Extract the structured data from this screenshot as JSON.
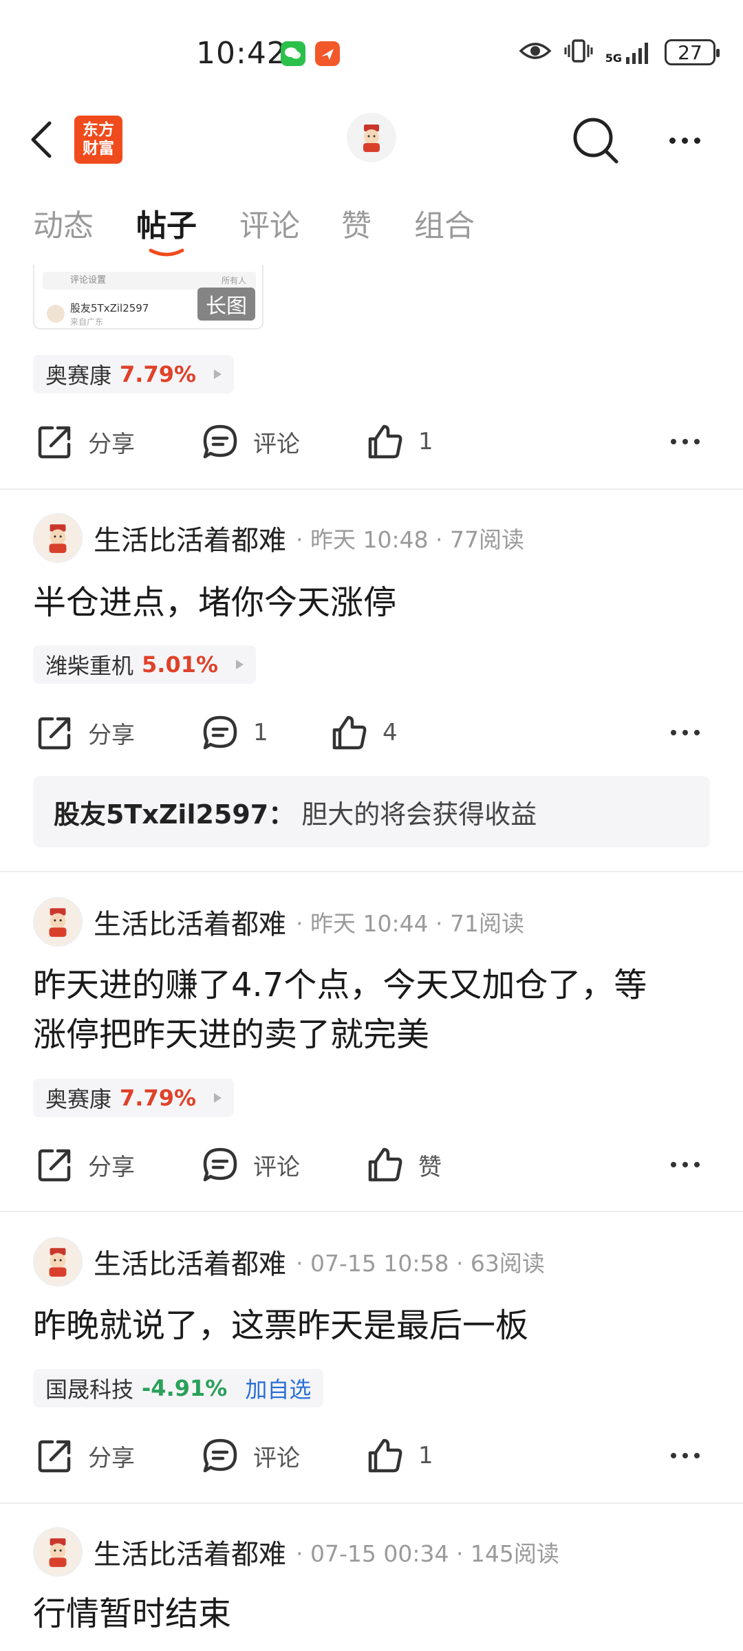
{
  "status_bar": {
    "time": "10:42",
    "network": "5G",
    "battery": "27",
    "icons": [
      "wechat-icon",
      "app-notification-icon",
      "eye-icon",
      "vibrate-icon",
      "signal-icon",
      "battery-icon"
    ]
  },
  "header": {
    "logo_line1": "东方",
    "logo_line2": "财富",
    "brand_color": "#f04b1c"
  },
  "tabs": [
    {
      "label": "动态",
      "active": false
    },
    {
      "label": "帖子",
      "active": true
    },
    {
      "label": "评论",
      "active": false
    },
    {
      "label": "赞",
      "active": false
    },
    {
      "label": "组合",
      "active": false
    }
  ],
  "image_preview": {
    "row1_label": "评论设置",
    "row1_right": "所有人",
    "user_name": "股友5TxZil2597",
    "user_location": "来自广东",
    "badge": "长图"
  },
  "posts": [
    {
      "stock": {
        "name": "奥赛康",
        "pct": "7.79%"
      },
      "actions": {
        "share": "分享",
        "comment": "评论",
        "like": "1"
      }
    },
    {
      "author": "生活比活着都难",
      "meta": "· 昨天 10:48 · 77阅读",
      "text": "半仓进点，堵你今天涨停",
      "stock": {
        "name": "潍柴重机",
        "pct": "5.01%"
      },
      "actions": {
        "share": "分享",
        "comment": "1",
        "like": "4"
      },
      "reply": {
        "user": "股友5TxZil2597：",
        "text": "胆大的将会获得收益"
      }
    },
    {
      "author": "生活比活着都难",
      "meta": "· 昨天 10:44 · 71阅读",
      "text_line1": "昨天进的赚了4.7个点，今天又加仓了，等",
      "text_line2": "涨停把昨天进的卖了就完美",
      "stock": {
        "name": "奥赛康",
        "pct": "7.79%"
      },
      "actions": {
        "share": "分享",
        "comment": "评论",
        "like": "赞"
      }
    },
    {
      "author": "生活比活着都难",
      "meta": "· 07-15 10:58 · 63阅读",
      "text": "昨晚就说了，这票昨天是最后一板",
      "stock": {
        "name": "国晟科技",
        "pct": "-4.91%",
        "add_watch": "加自选"
      },
      "actions": {
        "share": "分享",
        "comment": "评论",
        "like": "1"
      }
    },
    {
      "author": "生活比活着都难",
      "meta": "· 07-15 00:34 · 145阅读",
      "text": "行情暂时结束"
    }
  ]
}
